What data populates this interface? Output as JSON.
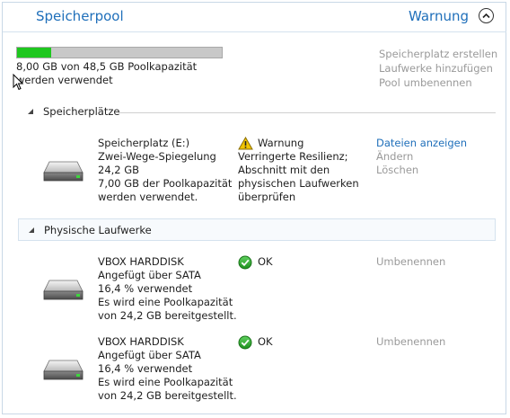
{
  "header": {
    "title": "Speicherpool",
    "status": "Warnung"
  },
  "pool": {
    "usage_fraction": 0.165,
    "usage_text": "8,00 GB von 48,5 GB Poolkapazität werden verwendet",
    "actions": [
      "Speicherplatz erstellen",
      "Laufwerke hinzufügen",
      "Pool umbenennen"
    ]
  },
  "spaces_section": {
    "title": "Speicherplätze",
    "items": [
      {
        "name": "Speicherplatz (E:)",
        "layout": "Zwei-Wege-Spiegelung",
        "size": "24,2 GB",
        "usage": "7,00 GB der Poolkapazität",
        "usage2": "werden verwendet.",
        "status": "Warnung",
        "status_detail": [
          "Verringerte Resilienz;",
          "Abschnitt mit den",
          "physischen Laufwerken",
          "überprüfen"
        ],
        "actions": [
          "Dateien anzeigen",
          "Ändern",
          "Löschen"
        ]
      }
    ]
  },
  "drives_section": {
    "title": "Physische Laufwerke",
    "items": [
      {
        "name": "VBOX HARDDISK",
        "attached": "Angefügt über SATA",
        "used": "16,4 % verwendet",
        "capacity1": "Es wird eine Poolkapazität",
        "capacity2": "von 24,2 GB bereitgestellt.",
        "status": "OK",
        "action": "Umbenennen"
      },
      {
        "name": "VBOX HARDDISK",
        "attached": "Angefügt über SATA",
        "used": "16,4 % verwendet",
        "capacity1": "Es wird eine Poolkapazität",
        "capacity2": "von 24,2 GB bereitgestellt.",
        "status": "OK",
        "action": "Umbenennen"
      }
    ]
  },
  "colors": {
    "accent": "#1f6fba",
    "bar_fill": "#1fc71f",
    "bar_bg": "#c8c8c8",
    "disabled": "#9a9a9a",
    "ok_green": "#2aa52a",
    "warning_yellow": "#f2c500"
  },
  "icons": {
    "collapse": "chevron-up-circle-icon",
    "warning": "warning-icon",
    "ok": "check-circle-icon",
    "drive": "hard-drive-icon",
    "expand": "triangle-collapse-icon",
    "cursor": "mouse-cursor-icon"
  }
}
